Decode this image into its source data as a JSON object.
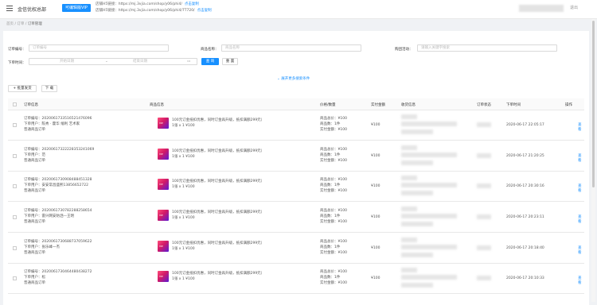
{
  "header": {
    "shop_name": "金信优权总部",
    "vip_label": "可编辑版VIP",
    "link1_label": "店铺H5链接：",
    "link1_url": "https://mj.3vjia.com/shop/y06/phi4/",
    "link2_label": "店铺H5链接：",
    "link2_url": "https://mj.3vjia.com/shop/y06/phi4/7T720/",
    "copy_label": "点击复制",
    "logout_label": "退出"
  },
  "breadcrumb": {
    "home": "首页",
    "sep": "/",
    "level1": "订单",
    "level2": "订单管理"
  },
  "filters": {
    "order_no_label": "订单编号：",
    "order_no_placeholder": "订单编号",
    "product_name_label": "商品名称：",
    "product_name_placeholder": "商品名称",
    "buyer_label": "购团活动：",
    "buyer_placeholder": "请输入关键字搜索",
    "time_label": "下单时间：",
    "start_placeholder": "开始日期",
    "end_placeholder": "结束日期",
    "query_label": "查 询",
    "reset_label": "重 置",
    "expand_label": "展开更多搜索条件"
  },
  "toolbar": {
    "batch_label": "批量发货",
    "export_label": "下 载"
  },
  "table": {
    "headers": [
      "订单信息",
      "商品信息",
      "价格/数量",
      "实付金额",
      "收货信息",
      "订单状态",
      "下单时间",
      "操作"
    ],
    "rows": [
      {
        "order_no": "订单编号：202006173351652147609​6",
        "buyer": "下单用户：陈秀 · 霍华 缅利 艺术家",
        "type": "普通商品订单",
        "product": "100元订金抵扣优惠，同时订金再升级，抵扣满额299元）",
        "qty_line": "1张 x 1   ¥100",
        "price_line1": "商品总价：¥100",
        "price_line2": "商品数：1件",
        "price_line3": "实付金额：¥100",
        "paid": "¥100",
        "time": "2020-06-17 22:05:17",
        "action": "查看"
      },
      {
        "order_no": "订单编号：202006173222283532410​69",
        "buyer": "下单用户：范",
        "type": "普通商品订单",
        "product": "100元订金抵扣优惠，同时订金再升级，抵扣满额299元）",
        "qty_line": "1张 x 1   ¥100",
        "price_line1": "商品总价：¥100",
        "price_line2": "商品数：1件",
        "price_line3": "实付金额：¥100",
        "paid": "¥100",
        "time": "2020-06-17 21:20:25",
        "action": "查看"
      },
      {
        "order_no": "订单编号：202006173090848845132​8",
        "buyer": "下单用户：安安常昌盛熙13856652722",
        "type": "普通商品订单",
        "product": "100元订金抵扣优惠，同时订金再升级，抵扣满额299元）",
        "qty_line": "1张 x 1   ¥100",
        "price_line1": "商品总价：¥100",
        "price_line2": "商品数：1件",
        "price_line3": "实付金额：¥100",
        "paid": "¥100",
        "time": "2020-06-17 20:30:16",
        "action": "查看"
      },
      {
        "order_no": "订单编号：202006173078228825865​4",
        "buyer": "下单用户：雷兴网安防洒—王明",
        "type": "普通商品订单",
        "product": "100元订金抵扣优惠，同时订金再升级，抵扣满额299元）",
        "qty_line": "1张 x 1   ¥100",
        "price_line1": "商品总价：¥100",
        "price_line2": "商品数：1件",
        "price_line3": "实付金额：¥100",
        "paid": "¥100",
        "time": "2020-06-17 20:23:11",
        "action": "查看"
      },
      {
        "order_no": "订单编号：202006173068873705962​2",
        "buyer": "下单用户：张乐峰一杰",
        "type": "普通商品订单",
        "product": "100元订金抵扣优惠，同时订金再升级，抵扣满额299元）",
        "qty_line": "1张 x 1   ¥100",
        "price_line1": "商品总价：¥100",
        "price_line2": "商品数：1件",
        "price_line3": "实付金额：¥100",
        "paid": "¥100",
        "time": "2020-06-17 20:18:40",
        "action": "查看"
      },
      {
        "order_no": "订单编号：202006173046448043827​2",
        "buyer": "下单用户：松",
        "type": "普通商品订单",
        "product": "100元订金抵扣优惠，同时订金再升级，抵扣满额299元）",
        "qty_line": "1张 x 1   ¥100",
        "price_line1": "商品总价：¥100",
        "price_line2": "商品数：1件",
        "price_line3": "实付金额：¥100",
        "paid": "¥100",
        "time": "2020-06-17 20:10:33",
        "action": "查看"
      }
    ]
  },
  "colors": {
    "primary": "#1890ff",
    "thumb_pink": "#ff4d7a",
    "thumb_purple": "#5a1bd6"
  },
  "icons": [
    "menu-icon",
    "calendar-icon",
    "chevron-down-icon",
    "plus-icon",
    "download-icon"
  ]
}
